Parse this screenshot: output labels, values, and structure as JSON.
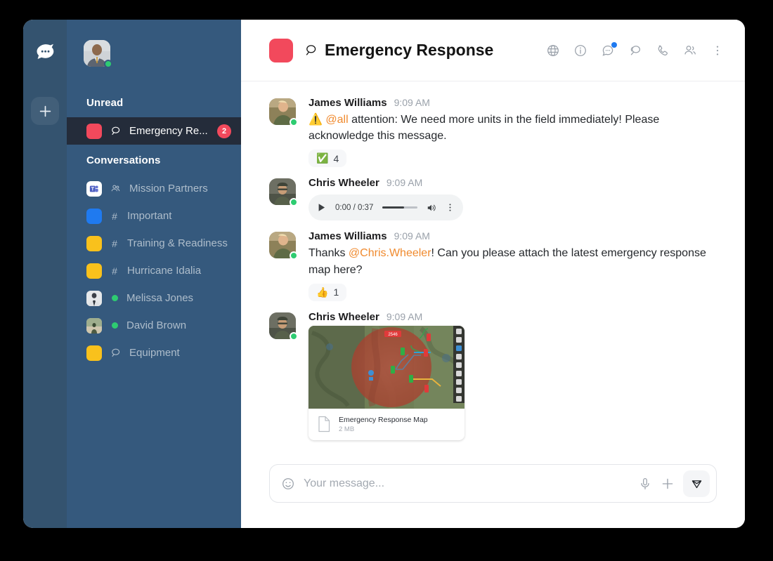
{
  "rail": {
    "logo_icon": "chat-rocket-logo",
    "add_label": "+"
  },
  "sidebar": {
    "user_avatar": "user-avatar",
    "sections": [
      {
        "title": "Unread"
      },
      {
        "title": "Conversations"
      }
    ],
    "unread_items": [
      {
        "label": "Emergency Re...",
        "icon": "channel-discussion-icon",
        "tile_color": "#f2495c",
        "badge": "2",
        "active": true
      }
    ],
    "conversation_items": [
      {
        "label": "Mission Partners",
        "icon": "team-icon",
        "tile_color": "#ffffff",
        "tile_kind": "teams"
      },
      {
        "label": "Important",
        "icon": "hash-icon",
        "tile_color": "#1f7af0",
        "tile_kind": "color"
      },
      {
        "label": "Training & Readiness",
        "icon": "hash-icon",
        "tile_color": "#f9c11c",
        "tile_kind": "color"
      },
      {
        "label": "Hurricane Idalia",
        "icon": "hash-icon",
        "tile_color": "#f9c11c",
        "tile_kind": "color"
      },
      {
        "label": "Melissa Jones",
        "icon": "presence-dot",
        "tile_color": "#b9bec4",
        "tile_kind": "avatar"
      },
      {
        "label": "David Brown",
        "icon": "presence-dot",
        "tile_color": "#b9bec4",
        "tile_kind": "avatar"
      },
      {
        "label": "Equipment",
        "icon": "channel-discussion-icon",
        "tile_color": "#f9c11c",
        "tile_kind": "color"
      }
    ]
  },
  "header": {
    "tile_color": "#f2495c",
    "channel_icon": "channel-discussion-icon",
    "title": "Emergency Response",
    "icons": [
      {
        "name": "globe-icon"
      },
      {
        "name": "info-icon"
      },
      {
        "name": "threads-icon",
        "badge": true
      },
      {
        "name": "discussions-icon"
      },
      {
        "name": "phone-icon"
      },
      {
        "name": "team-members-icon"
      },
      {
        "name": "kebab-menu-icon"
      }
    ]
  },
  "messages": [
    {
      "author": "James Williams",
      "time": "9:09 AM",
      "type": "text",
      "text_parts": [
        {
          "kind": "emoji",
          "value": "⚠️"
        },
        {
          "kind": "mention",
          "value": "@all"
        },
        {
          "kind": "plain",
          "value": " attention: We need more units in the field immediately! Please acknowledge this message."
        }
      ],
      "reaction": {
        "emoji": "✅",
        "count": "4"
      }
    },
    {
      "author": "Chris Wheeler",
      "time": "9:09 AM",
      "type": "audio",
      "audio": {
        "time_label": "0:00 / 0:37",
        "play_icon": "play-icon",
        "volume_icon": "volume-icon",
        "menu_icon": "kebab-menu-icon"
      }
    },
    {
      "author": "James Williams",
      "time": "9:09 AM",
      "type": "text",
      "text_parts": [
        {
          "kind": "plain",
          "value": "Thanks "
        },
        {
          "kind": "mention",
          "value": "@Chris.Wheeler"
        },
        {
          "kind": "plain",
          "value": "! Can you please attach the latest emergency response map here?"
        }
      ],
      "reaction": {
        "emoji": "👍",
        "count": "1"
      }
    },
    {
      "author": "Chris Wheeler",
      "time": "9:09 AM",
      "type": "attachment",
      "attachment": {
        "preview": "emergency-response-map-preview",
        "name": "Emergency Response Map",
        "size": "2 MB",
        "map_label": "2546"
      }
    }
  ],
  "composer": {
    "emoji_icon": "emoji-icon",
    "placeholder": "Your message...",
    "value": "",
    "mic_icon": "microphone-icon",
    "plus_icon": "plus-icon",
    "send_icon": "send-icon"
  },
  "colors": {
    "rail": "#34536f",
    "sidebar": "#35597d",
    "active_item": "#242c3a",
    "accent_red": "#f2495c",
    "accent_yellow": "#f9c11c",
    "accent_blue": "#1f7af0",
    "mention": "#f08a2e",
    "presence_green": "#2ecc71"
  }
}
